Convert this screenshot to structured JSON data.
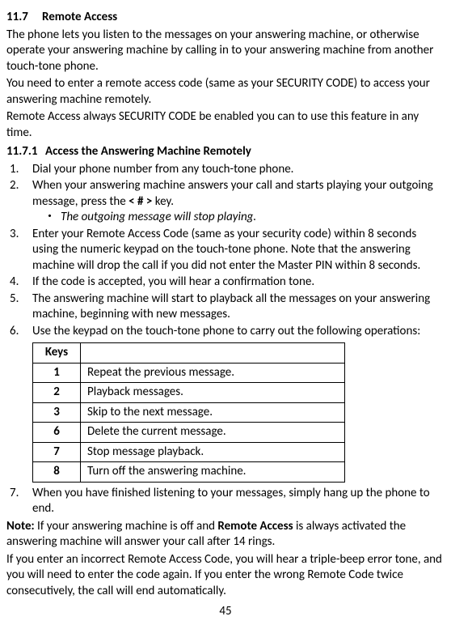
{
  "section": {
    "number": "11.7",
    "title": "Remote Access"
  },
  "intro": {
    "p1": "The phone lets you listen to the messages on your answering machine, or otherwise operate your answering machine by calling in to your answering machine from another touch-tone phone.",
    "p2": "You need to enter a remote access code (same as your SECURITY CODE) to access your answering machine remotely.",
    "p3": "Remote Access always SECURITY CODE be enabled you can to use this feature in any time."
  },
  "subsection": {
    "number": "11.7.1",
    "title": "Access the Answering Machine Remotely"
  },
  "steps": [
    "Dial your phone number from any touch-tone phone.",
    "When your answering machine answers your call and starts playing your outgoing message, press the ",
    "Enter your Remote Access Code (same as your security code) within 8 seconds using the numeric keypad on the touch-tone phone. Note that the answering machine will drop the call if you did not enter the Master PIN within 8 seconds.",
    "If the code is accepted, you will hear a confirmation tone.",
    "The answering machine will start to playback all the messages on your answering machine, beginning with new messages.",
    "Use the keypad on the touch-tone phone to carry out the following operations:",
    "When you have finished listening to your messages, simply hang up the phone to end."
  ],
  "step2_key": "< # >",
  "step2_tail": " key.",
  "step2_note": "The outgoing message will stop playing.",
  "table": {
    "header_keys": "Keys",
    "rows": [
      {
        "key": "1",
        "desc": "Repeat the previous message."
      },
      {
        "key": "2",
        "desc": "Playback messages."
      },
      {
        "key": "3",
        "desc": "Skip to the next message."
      },
      {
        "key": "6",
        "desc": "Delete the current message."
      },
      {
        "key": "7",
        "desc": "Stop message playback."
      },
      {
        "key": "8",
        "desc": "Turn off the answering machine."
      }
    ]
  },
  "note": {
    "label": "Note:",
    "text1": " If your answering machine is off and ",
    "bold": "Remote Access",
    "text2": " is always activated the answering machine will answer your call after 14 rings.",
    "p2": "If you enter an incorrect Remote Access Code, you will hear a triple-beep error tone, and you will need to enter the code again. If you enter the wrong Remote Code twice consecutively, the call will end automatically."
  },
  "page_number": "45"
}
